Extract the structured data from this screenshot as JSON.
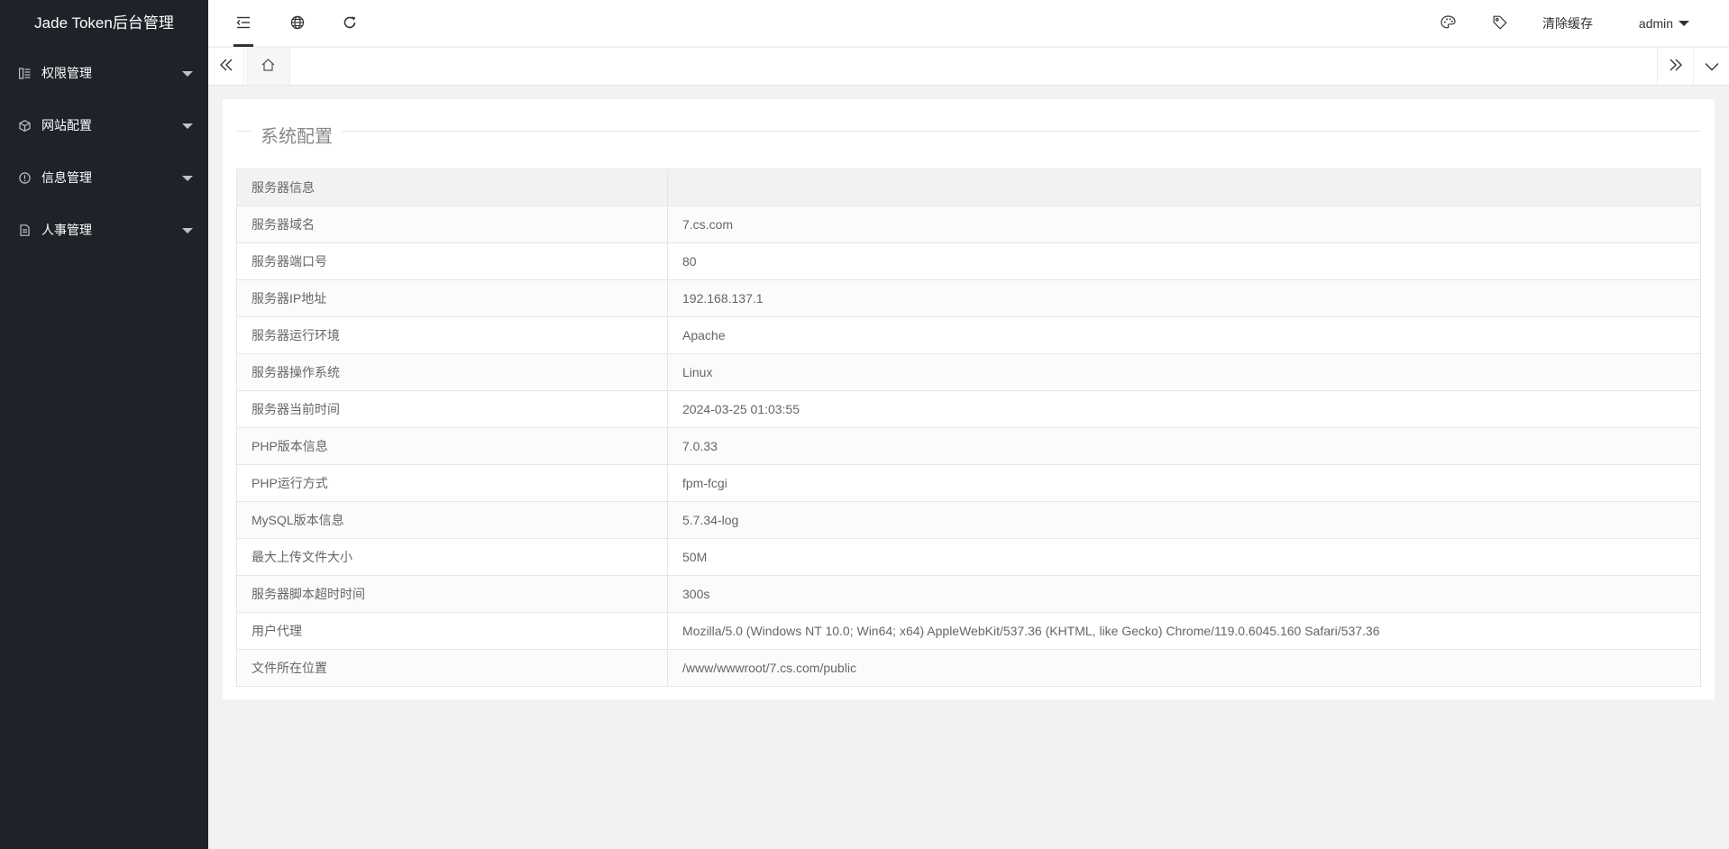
{
  "app": {
    "title": "Jade Token后台管理"
  },
  "sidebar": {
    "items": [
      {
        "label": "权限管理",
        "icon": "list-icon"
      },
      {
        "label": "网站配置",
        "icon": "cube-icon"
      },
      {
        "label": "信息管理",
        "icon": "info-circle-icon"
      },
      {
        "label": "人事管理",
        "icon": "document-icon"
      }
    ]
  },
  "header": {
    "icons": [
      "menu-fold-icon",
      "globe-icon",
      "refresh-icon",
      "palette-icon",
      "tag-icon"
    ],
    "clear_cache": "清除缓存",
    "user": "admin"
  },
  "tabs": {
    "icons": [
      "double-chevron-left-icon",
      "home-icon",
      "double-chevron-right-icon",
      "chevron-down-icon"
    ]
  },
  "main": {
    "section_title": "系统配置",
    "table_header": {
      "key": "服务器信息",
      "value": ""
    },
    "rows": [
      {
        "key": "服务器域名",
        "value": "7.cs.com"
      },
      {
        "key": "服务器端口号",
        "value": "80"
      },
      {
        "key": "服务器IP地址",
        "value": "192.168.137.1"
      },
      {
        "key": "服务器运行环境",
        "value": "Apache"
      },
      {
        "key": "服务器操作系统",
        "value": "Linux"
      },
      {
        "key": "服务器当前时间",
        "value": "2024-03-25 01:03:55"
      },
      {
        "key": "PHP版本信息",
        "value": "7.0.33"
      },
      {
        "key": "PHP运行方式",
        "value": "fpm-fcgi"
      },
      {
        "key": "MySQL版本信息",
        "value": "5.7.34-log"
      },
      {
        "key": "最大上传文件大小",
        "value": "50M"
      },
      {
        "key": "服务器脚本超时时间",
        "value": "300s"
      },
      {
        "key": "用户代理",
        "value": "Mozilla/5.0 (Windows NT 10.0; Win64; x64) AppleWebKit/537.36 (KHTML, like Gecko) Chrome/119.0.6045.160 Safari/537.36"
      },
      {
        "key": "文件所在位置",
        "value": "/www/wwwroot/7.cs.com/public"
      }
    ]
  },
  "colors": {
    "sidebar_bg": "#20222a",
    "page_bg": "#f2f2f2",
    "card_bg": "#ffffff"
  }
}
